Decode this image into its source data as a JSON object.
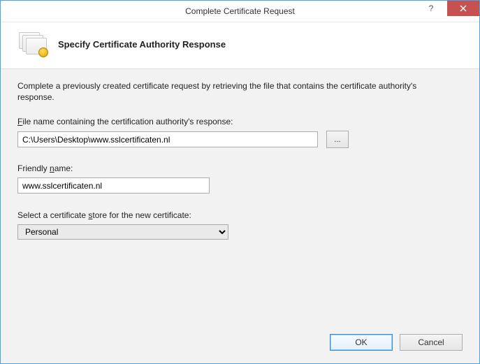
{
  "window": {
    "title": "Complete Certificate Request"
  },
  "header": {
    "heading": "Specify Certificate Authority Response"
  },
  "content": {
    "description": "Complete a previously created certificate request by retrieving the file that contains the certificate authority's response.",
    "fileLabelPre": "F",
    "fileLabelPost": "ile name containing the certification authority's response:",
    "fileValue": "C:\\Users\\Desktop\\www.sslcertificaten.nl",
    "browseLabel": "...",
    "friendlyLabelPre": "Friendly ",
    "friendlyLabelAccel": "n",
    "friendlyLabelPost": "ame:",
    "friendlyValue": "www.sslcertificaten.nl",
    "storeLabelPre": "Select a certificate ",
    "storeLabelAccel": "s",
    "storeLabelPost": "tore for the new certificate:",
    "storeValue": "Personal"
  },
  "buttons": {
    "ok": "OK",
    "cancel": "Cancel",
    "help": "?"
  }
}
